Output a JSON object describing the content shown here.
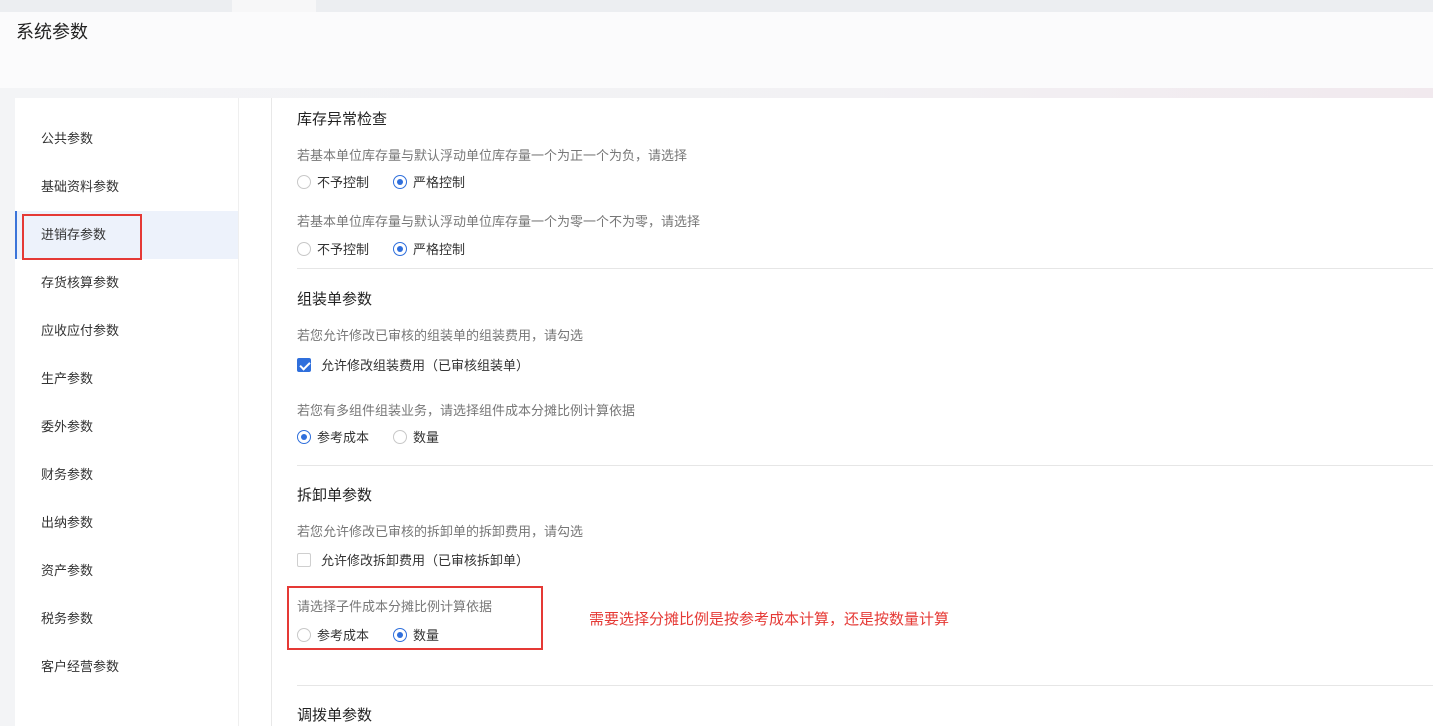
{
  "page": {
    "title": "系统参数"
  },
  "colors": {
    "accent": "#2f6fdc",
    "annotation": "#e53935",
    "active_bg": "#edf2fb"
  },
  "sidebar": {
    "items": [
      {
        "label": "公共参数"
      },
      {
        "label": "基础资料参数"
      },
      {
        "label": "进销存参数",
        "active": true
      },
      {
        "label": "存货核算参数"
      },
      {
        "label": "应收应付参数"
      },
      {
        "label": "生产参数"
      },
      {
        "label": "委外参数"
      },
      {
        "label": "财务参数"
      },
      {
        "label": "出纳参数"
      },
      {
        "label": "资产参数"
      },
      {
        "label": "税务参数"
      },
      {
        "label": "客户经营参数"
      }
    ]
  },
  "inventory_check": {
    "title": "库存异常检查",
    "q1": {
      "hint": "若基本单位库存量与默认浮动单位库存量一个为正一个为负，请选择",
      "options": [
        "不予控制",
        "严格控制"
      ],
      "selected": "严格控制"
    },
    "q2": {
      "hint": "若基本单位库存量与默认浮动单位库存量一个为零一个不为零，请选择",
      "options": [
        "不予控制",
        "严格控制"
      ],
      "selected": "严格控制"
    }
  },
  "assembly": {
    "title": "组装单参数",
    "edit_hint": "若您允许修改已审核的组装单的组装费用，请勾选",
    "edit_checkbox": {
      "label": "允许修改组装费用（已审核组装单）",
      "checked": true
    },
    "basis_hint": "若您有多组件组装业务，请选择组件成本分摊比例计算依据",
    "basis_options": [
      "参考成本",
      "数量"
    ],
    "basis_selected": "参考成本"
  },
  "disassembly": {
    "title": "拆卸单参数",
    "edit_hint": "若您允许修改已审核的拆卸单的拆卸费用，请勾选",
    "edit_checkbox": {
      "label": "允许修改拆卸费用（已审核拆卸单）",
      "checked": false
    },
    "basis_hint": "请选择子件成本分摊比例计算依据",
    "basis_options": [
      "参考成本",
      "数量"
    ],
    "basis_selected": "数量"
  },
  "annotation": "需要选择分摊比例是按参考成本计算，还是按数量计算",
  "transfer": {
    "title": "调拨单参数"
  }
}
